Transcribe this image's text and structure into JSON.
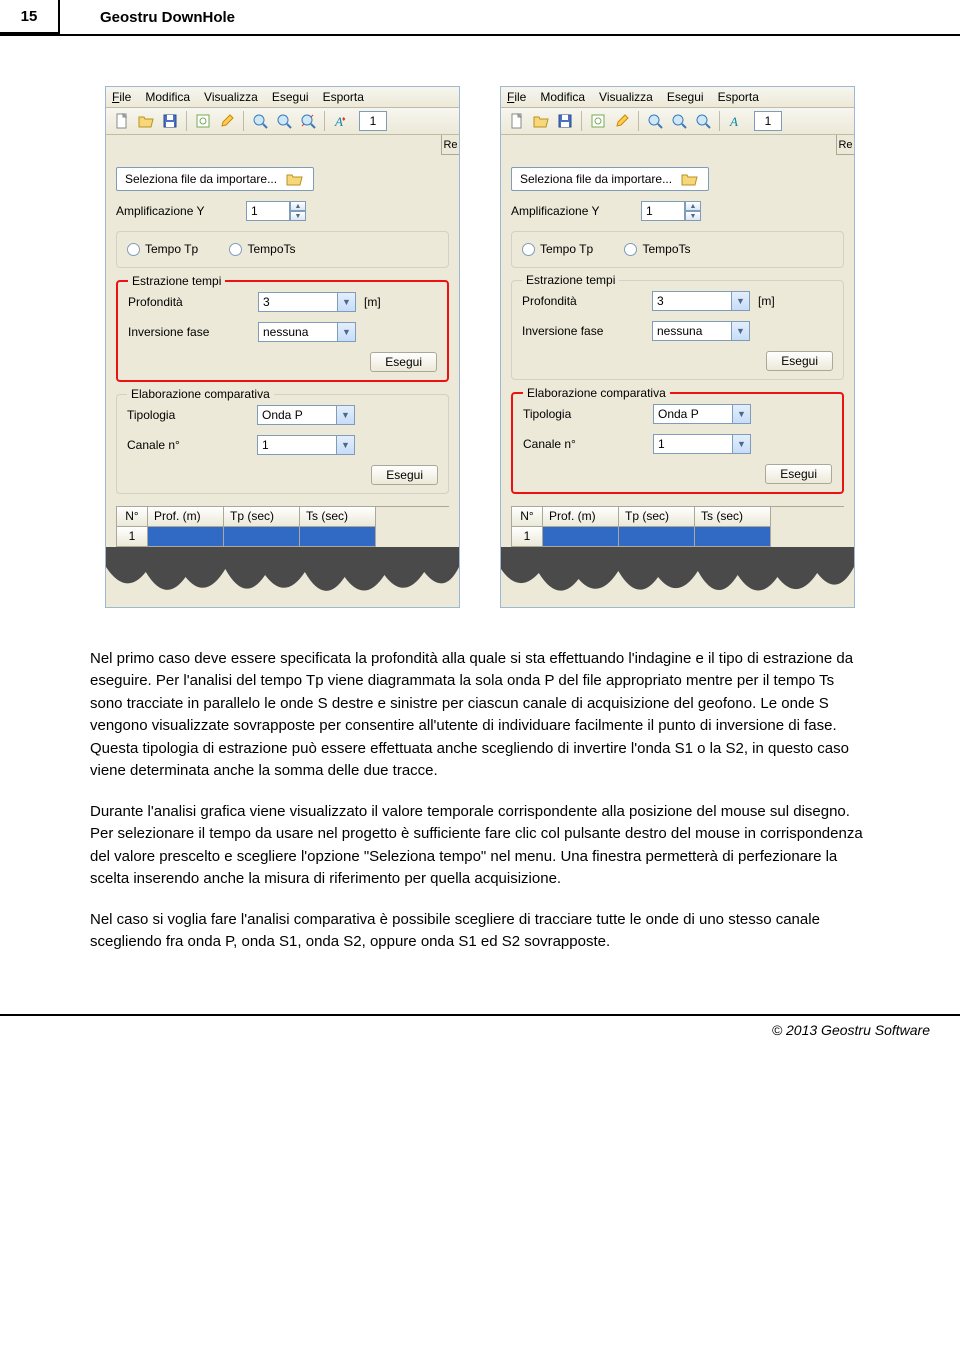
{
  "page_number": "15",
  "page_title": "Geostru DownHole",
  "footer": "© 2013 Geostru Software",
  "menu": [
    "File",
    "Modifica",
    "Visualizza",
    "Esegui",
    "Esporta"
  ],
  "menu_ul": [
    "F",
    "",
    "",
    "",
    ""
  ],
  "toolbar_value": "1",
  "rpanel_label": "Re",
  "import_btn": "Seleziona file da importare...",
  "amp_label": "Amplificazione Y",
  "amp_value": "1",
  "radio_tp": "Tempo Tp",
  "radio_ts": "TempoTs",
  "fs_estr": "Estrazione tempi",
  "prof_label": "Profondità",
  "prof_value": "3",
  "prof_unit": "[m]",
  "inv_label": "Inversione fase",
  "inv_value": "nessuna",
  "esegui": "Esegui",
  "fs_elab": "Elaborazione comparativa",
  "tip_label": "Tipologia",
  "tip_value": "Onda P",
  "can_label": "Canale n°",
  "can_value": "1",
  "th1": "N°",
  "th2": "Prof. (m)",
  "th3": "Tp (sec)",
  "th4": "Ts (sec)",
  "row_n": "1",
  "panels": [
    {
      "highlight": "estrazione"
    },
    {
      "highlight": "elaborazione"
    }
  ],
  "para1": "Nel primo caso deve essere specificata la profondità alla quale si sta effettuando l'indagine e il tipo di estrazione da eseguire. Per l'analisi del tempo Tp viene diagrammata la sola onda P del file appropriato mentre per il tempo Ts sono tracciate in parallelo le onde S destre e sinistre per ciascun canale di acquisizione del geofono. Le onde S vengono visualizzate sovrapposte per consentire all'utente di individuare facilmente il punto di inversione di fase. Questa tipologia di estrazione può essere effettuata anche scegliendo di invertire l'onda S1 o la S2, in questo caso viene determinata anche la somma delle due tracce.",
  "para2": "Durante l'analisi grafica viene visualizzato il valore temporale corrispondente alla posizione del mouse sul disegno. Per selezionare il tempo da usare nel progetto è sufficiente fare clic col pulsante destro del mouse in corrispondenza del valore prescelto e scegliere l'opzione \"Seleziona tempo\" nel menu. Una finestra permetterà di perfezionare la scelta inserendo anche la misura di riferimento per quella acquisizione.",
  "para3": "Nel caso si voglia fare l'analisi comparativa è possibile scegliere di tracciare tutte le onde di uno stesso canale scegliendo fra onda P, onda S1, onda S2, oppure onda S1 ed S2 sovrapposte."
}
